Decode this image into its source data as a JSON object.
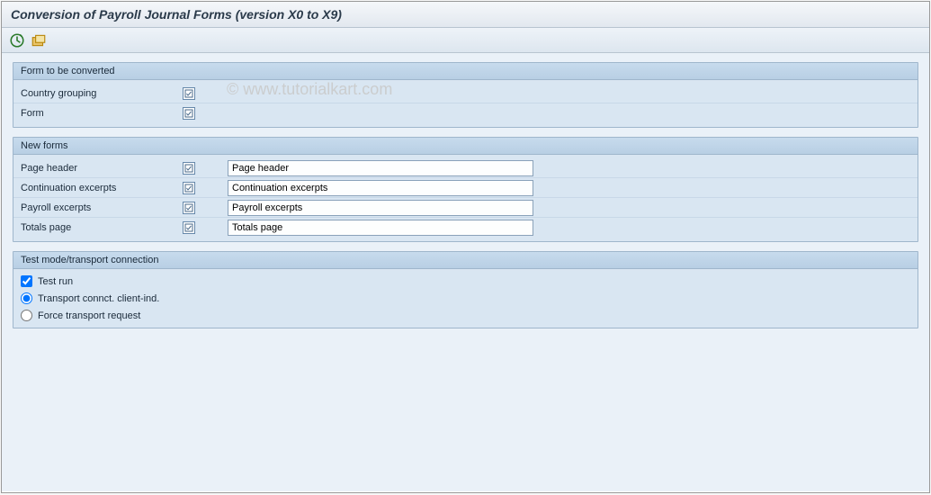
{
  "title": "Conversion of Payroll Journal Forms (version X0 to X9)",
  "watermark": "© www.tutorialkart.com",
  "groups": {
    "convert": {
      "legend": "Form to be converted",
      "country_label": "Country grouping",
      "form_label": "Form"
    },
    "newforms": {
      "legend": "New forms",
      "rows": [
        {
          "label": "Page header",
          "value": "Page header"
        },
        {
          "label": "Continuation excerpts",
          "value": "Continuation excerpts"
        },
        {
          "label": "Payroll excerpts",
          "value": "Payroll excerpts"
        },
        {
          "label": "Totals page",
          "value": "Totals page"
        }
      ]
    },
    "testmode": {
      "legend": "Test mode/transport connection",
      "testrun_label": "Test run",
      "testrun_checked": true,
      "radio_transport_label": "Transport connct. client-ind.",
      "radio_force_label": "Force transport request",
      "radio_selected": "transport"
    }
  }
}
